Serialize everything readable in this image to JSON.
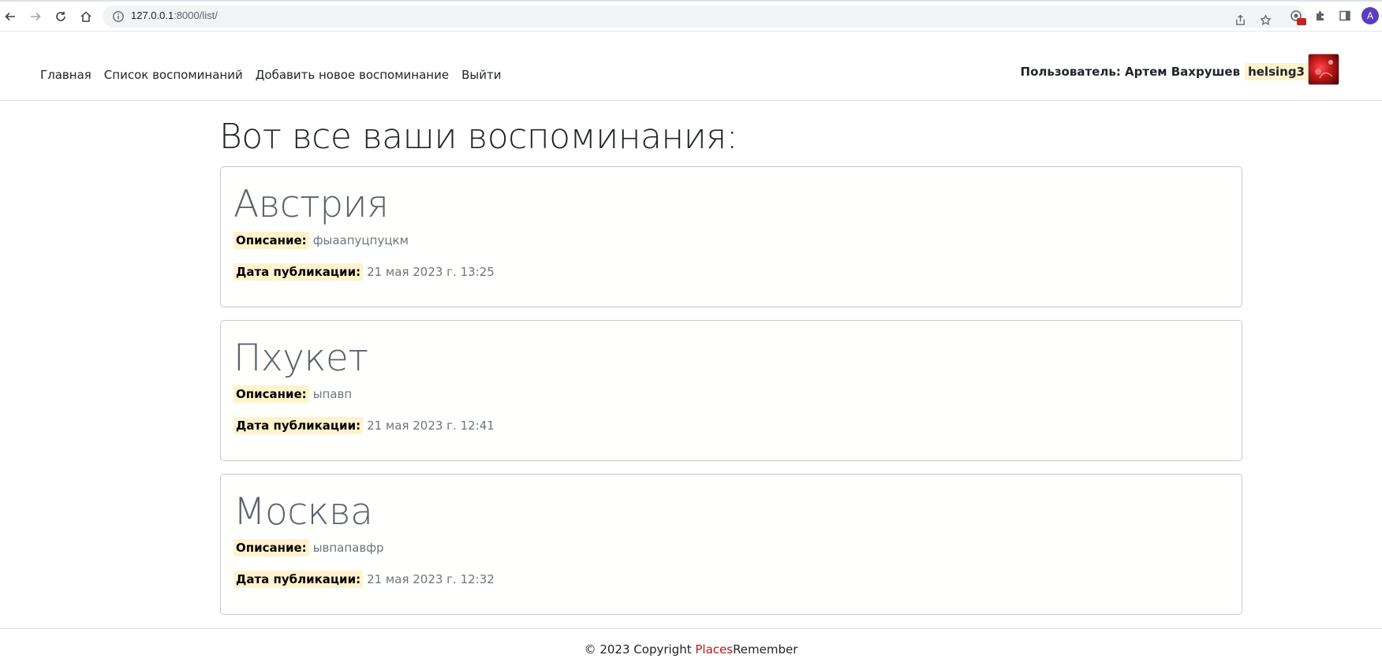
{
  "browser": {
    "url_host": "127.0.0.1",
    "url_path": ":8000/list/",
    "profile_initial": "A"
  },
  "header": {
    "nav": [
      {
        "label": "Главная"
      },
      {
        "label": "Список воспоминаний"
      },
      {
        "label": "Добавить новое воспоминание"
      },
      {
        "label": "Выйти"
      }
    ],
    "user_label": "Пользователь: Артем Вахрушев",
    "username": "helsing3"
  },
  "main": {
    "title": "Вот все ваши воспоминания:",
    "description_label": "Описание:",
    "date_label": "Дата публикации:",
    "memories": [
      {
        "title": "Австрия",
        "description": "фыаапуцпуцкм",
        "date": "21 мая 2023 г. 13:25"
      },
      {
        "title": "Пхукет",
        "description": "ыпавп",
        "date": "21 мая 2023 г. 12:41"
      },
      {
        "title": "Москва",
        "description": "ывпапавфр",
        "date": "21 мая 2023 г. 12:32"
      }
    ]
  },
  "footer": {
    "prefix": "© 2023 Copyright ",
    "brand_red": "Places",
    "brand_rest": "Remember"
  },
  "colors": {
    "highlight": "#fff3cd",
    "brand_red": "#c0171c",
    "profile": "#5b3cc4"
  }
}
